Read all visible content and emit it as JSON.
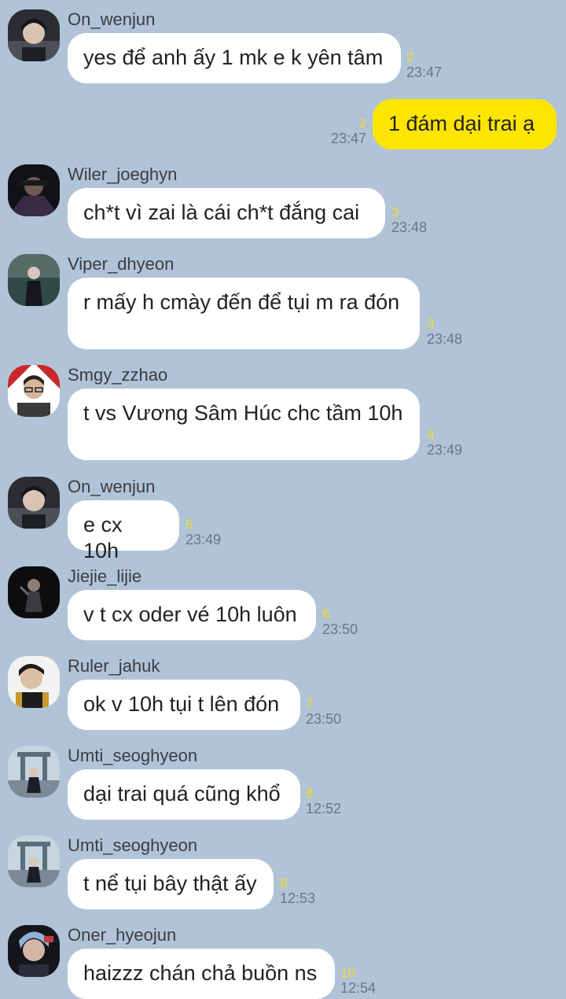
{
  "colors": {
    "background": "#b1c3d7",
    "own_bubble": "#fee500",
    "other_bubble": "#ffffff",
    "unread": "#f1dc2c"
  },
  "messages": [
    {
      "sender": "On_wenjun",
      "text": "yes để anh ấy 1 mk e k yên tâm",
      "unread": "2",
      "time": "23:47",
      "avatar": "dark-hair-avatar"
    },
    {
      "own": true,
      "text": "1 đám dại trai ạ",
      "unread": "2",
      "time": "23:47"
    },
    {
      "sender": "Wiler_joeghyn",
      "text": "ch*t vì zai là cái ch*t đắng cai",
      "unread": "3",
      "time": "23:48",
      "avatar": "stage-avatar"
    },
    {
      "sender": "Viper_dhyeon",
      "text": "r mấy h cmày đến để tụi m ra đón",
      "unread": "3",
      "time": "23:48",
      "avatar": "suit-avatar"
    },
    {
      "sender": "Smgy_zzhao",
      "text": "t vs Vương Sâm Húc chc tầm 10h",
      "unread": "4",
      "time": "23:49",
      "avatar": "glasses-avatar"
    },
    {
      "sender": "On_wenjun",
      "text": "e cx 10h",
      "unread": "5",
      "time": "23:49",
      "avatar": "dark-hair-avatar"
    },
    {
      "sender": "Jiejie_lijie",
      "text": "v t cx oder vé 10h luôn",
      "unread": "6",
      "time": "23:50",
      "avatar": "dark-stage-avatar"
    },
    {
      "sender": "Ruler_jahuk",
      "text": "ok v 10h tụi t lên đón",
      "unread": "7",
      "time": "23:50",
      "avatar": "profile-avatar"
    },
    {
      "sender": "Umti_seoghyeon",
      "text": "dại trai quá cũng khổ",
      "unread": "8",
      "time": "12:52",
      "avatar": "outdoor-avatar"
    },
    {
      "sender": "Umti_seoghyeon",
      "text": "t nể tụi bây thật ấy",
      "unread": "8",
      "time": "12:53",
      "avatar": "outdoor-avatar"
    },
    {
      "sender": "Oner_hyeojun",
      "text": "haizzz chán chả buồn ns",
      "unread": "10",
      "time": "12:54",
      "avatar": "blue-hair-avatar"
    }
  ]
}
